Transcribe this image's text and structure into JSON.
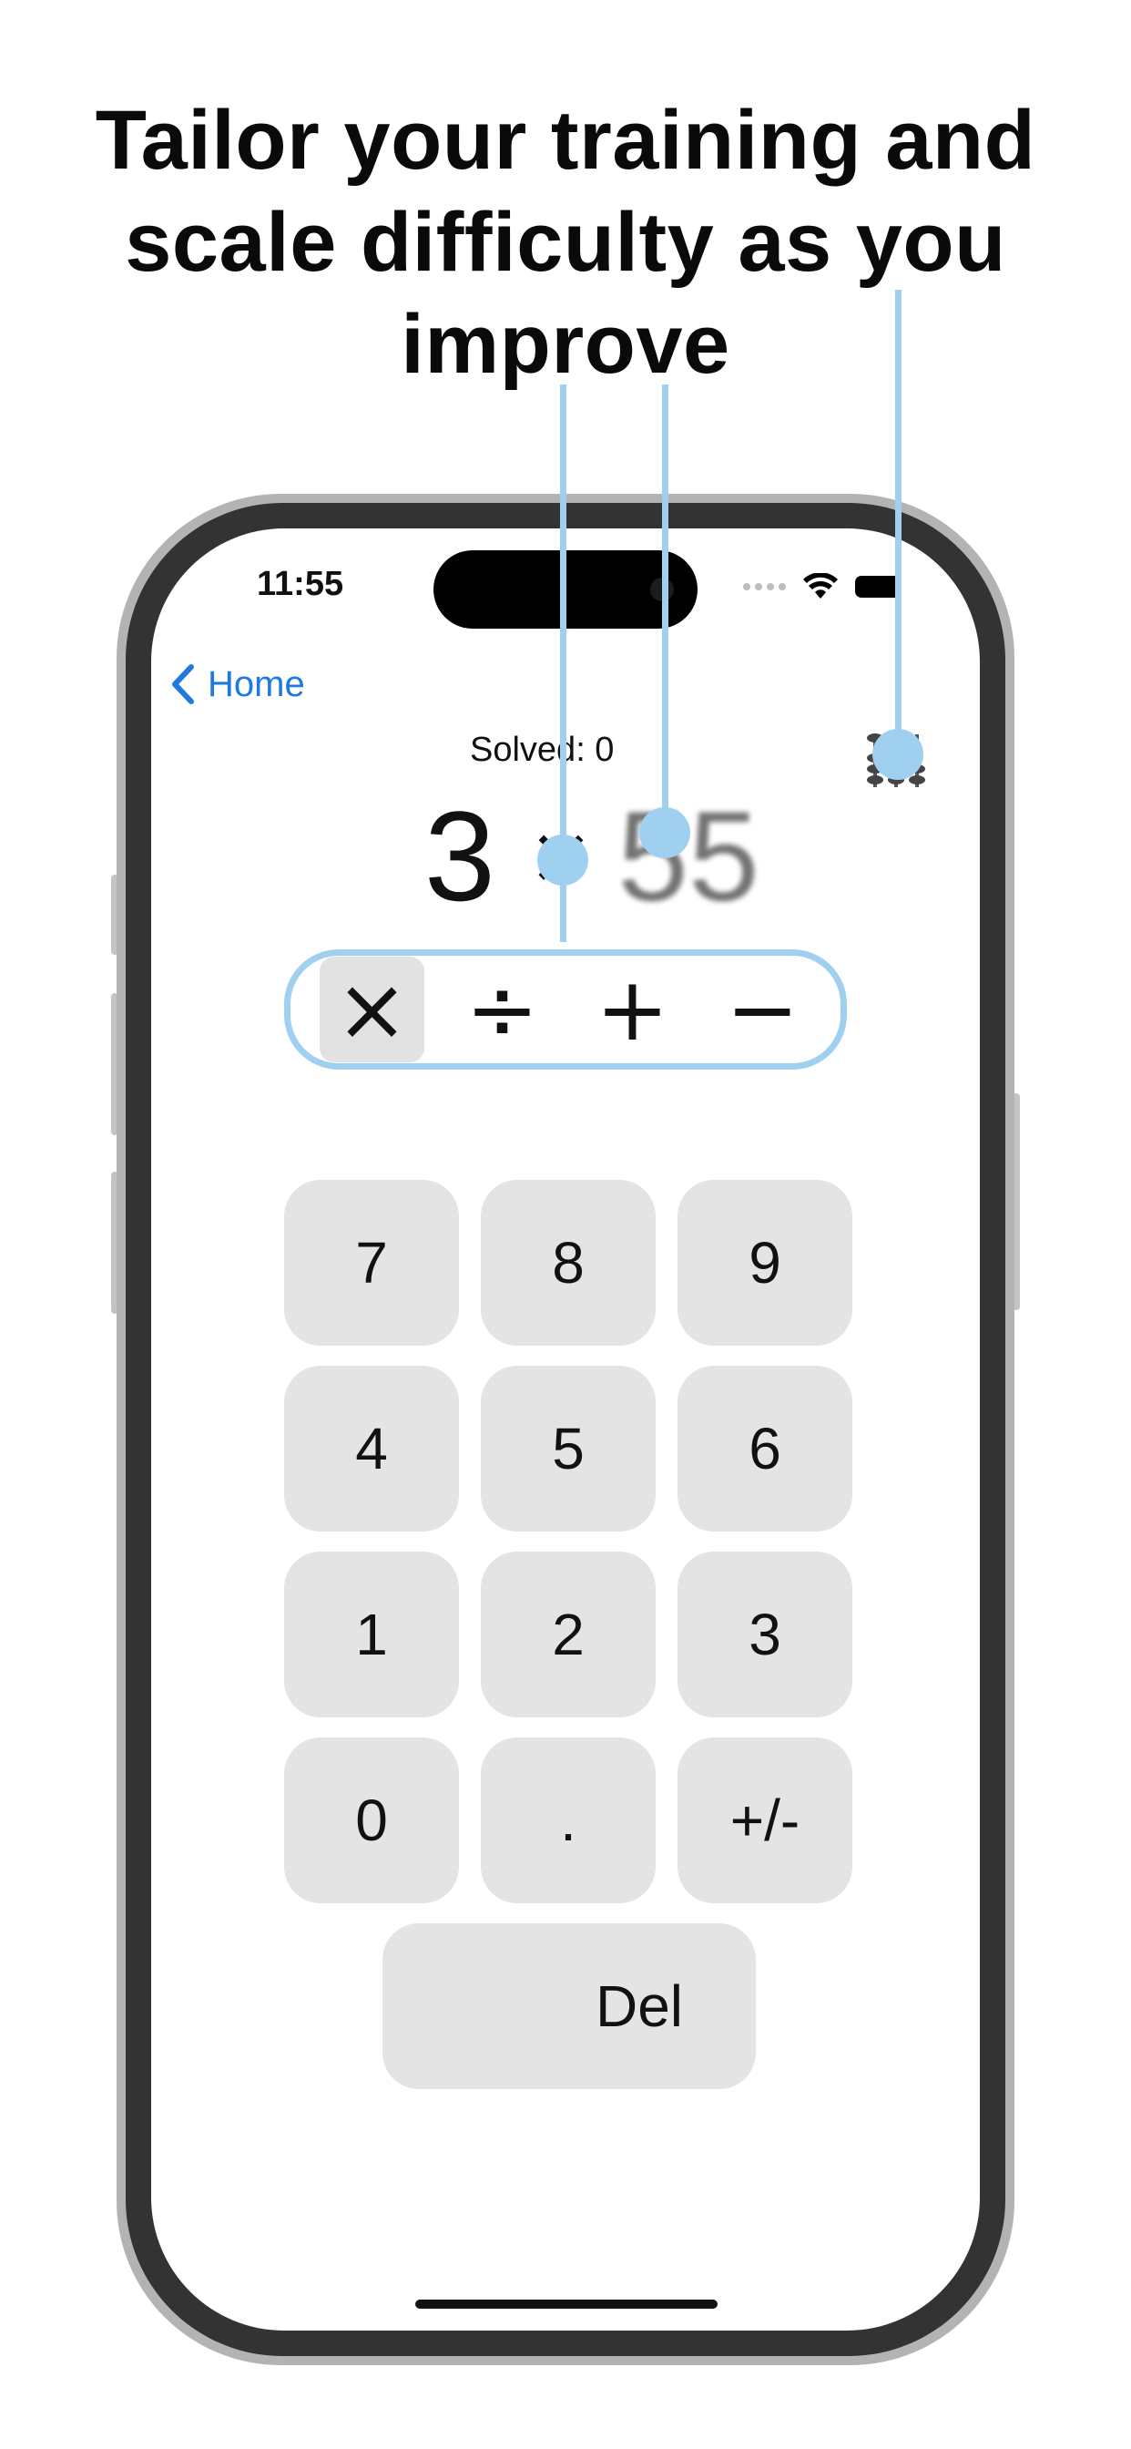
{
  "headline": {
    "line1": "Tailor your training and",
    "line2": "scale difficulty as you",
    "line3": "improve"
  },
  "status_bar": {
    "time": "11:55",
    "icons": [
      "signal-dots-icon",
      "wifi-icon",
      "battery-icon"
    ]
  },
  "nav": {
    "back_label": "Home",
    "back_icon": "chevron-left-icon",
    "settings_icon": "abacus-icon"
  },
  "progress": {
    "solved_label": "Solved: 0"
  },
  "problem": {
    "left": "3",
    "operator": "×",
    "right": "55"
  },
  "operators": {
    "items": [
      {
        "label": "×",
        "selected": true
      },
      {
        "label": "÷",
        "selected": false
      },
      {
        "label": "+",
        "selected": false
      },
      {
        "label": "−",
        "selected": false
      }
    ]
  },
  "keypad": {
    "keys": [
      "7",
      "8",
      "9",
      "4",
      "5",
      "6",
      "1",
      "2",
      "3",
      "0",
      ".",
      "+/-"
    ],
    "delete_label": "Del"
  },
  "colors": {
    "accent": "#1f7ae0",
    "callout": "#9fd0ef",
    "key_bg": "#e4e4e4",
    "frame": "#333333"
  }
}
